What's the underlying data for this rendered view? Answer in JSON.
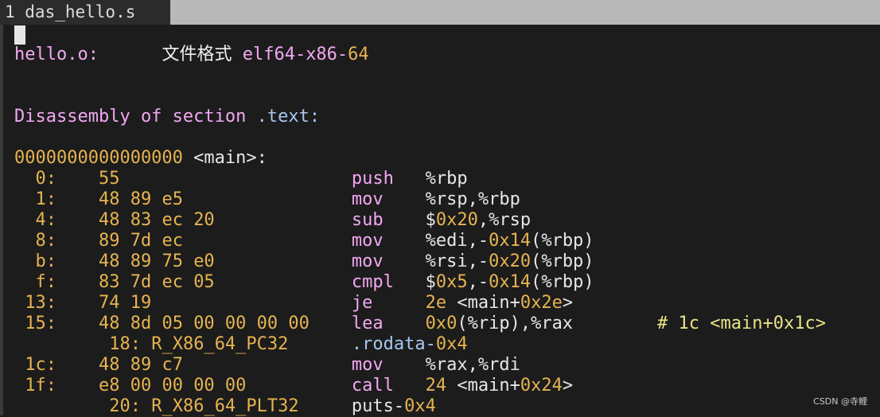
{
  "tab": {
    "label": "1 das_hello.s"
  },
  "header": {
    "file": "hello.o:",
    "format_label": "文件格式",
    "format_prefix": "elf64-x86-",
    "format_suffix": "64"
  },
  "section": {
    "text": "Disassembly of section",
    "name": ".text:"
  },
  "symbol": {
    "address": "0000000000000000",
    "name": "<main>:"
  },
  "lines": [
    {
      "offset": "0:",
      "bytes": "55",
      "op": "push",
      "args": [
        [
          "%rbp",
          "light"
        ]
      ]
    },
    {
      "offset": "1:",
      "bytes": "48 89 e5",
      "op": "mov",
      "args": [
        [
          "%rsp,%rbp",
          "light"
        ]
      ]
    },
    {
      "offset": "4:",
      "bytes": "48 83 ec 20",
      "op": "sub",
      "args": [
        [
          "$",
          "light"
        ],
        [
          "0x20",
          "orange"
        ],
        [
          ",%rsp",
          "light"
        ]
      ]
    },
    {
      "offset": "8:",
      "bytes": "89 7d ec",
      "op": "mov",
      "args": [
        [
          "%edi,-",
          "light"
        ],
        [
          "0x14",
          "orange"
        ],
        [
          "(%rbp)",
          "light"
        ]
      ]
    },
    {
      "offset": "b:",
      "bytes": "48 89 75 e0",
      "op": "mov",
      "args": [
        [
          "%rsi,-",
          "light"
        ],
        [
          "0x20",
          "orange"
        ],
        [
          "(%rbp)",
          "light"
        ]
      ]
    },
    {
      "offset": "f:",
      "bytes": "83 7d ec 05",
      "op": "cmpl",
      "args": [
        [
          "$",
          "light"
        ],
        [
          "0x5",
          "orange"
        ],
        [
          ",-",
          "light"
        ],
        [
          "0x14",
          "orange"
        ],
        [
          "(%rbp)",
          "light"
        ]
      ]
    },
    {
      "offset": "13:",
      "bytes": "74 19",
      "op": "je",
      "args": [
        [
          "2e",
          "orange"
        ],
        [
          " <main+",
          "light"
        ],
        [
          "0x2e",
          "orange"
        ],
        [
          ">",
          "light"
        ]
      ]
    },
    {
      "offset": "15:",
      "bytes": "48 8d 05 00 00 00 00",
      "op": "lea",
      "args": [
        [
          "0x0",
          "orange"
        ],
        [
          "(%rip),%rax",
          "light"
        ]
      ],
      "comment": [
        [
          "# 1c <main+",
          "yellow"
        ],
        [
          "0x1c",
          "yellow"
        ],
        [
          ">",
          "yellow"
        ]
      ]
    },
    {
      "reloc_offset": "18:",
      "reloc_name": "R_X86_64_PC32",
      "reloc_target": [
        [
          ".rodata-",
          "blue"
        ],
        [
          "0x4",
          "orange"
        ]
      ]
    },
    {
      "offset": "1c:",
      "bytes": "48 89 c7",
      "op": "mov",
      "args": [
        [
          "%rax,%rdi",
          "light"
        ]
      ]
    },
    {
      "offset": "1f:",
      "bytes": "e8 00 00 00 00",
      "op": "call",
      "args": [
        [
          "24",
          "orange"
        ],
        [
          " <main+",
          "light"
        ],
        [
          "0x24",
          "orange"
        ],
        [
          ">",
          "light"
        ]
      ]
    },
    {
      "reloc_offset": "20:",
      "reloc_name": "R_X86_64_PLT32",
      "reloc_target": [
        [
          "puts-",
          "light"
        ],
        [
          "0x4",
          "orange"
        ]
      ]
    }
  ],
  "watermark": "CSDN @寺鲤"
}
